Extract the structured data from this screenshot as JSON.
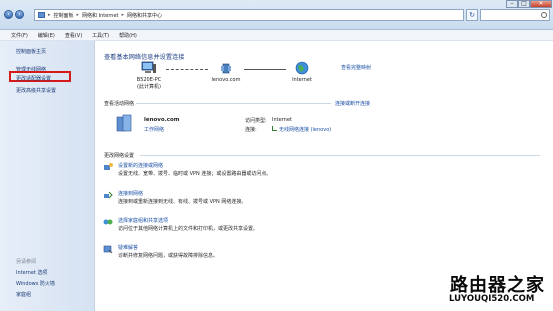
{
  "address_bar": {
    "segments": [
      "控制面板",
      "网络和 Internet",
      "网络和共享中心"
    ],
    "separator": "▸"
  },
  "menu": [
    "文件(F)",
    "编辑(E)",
    "查看(V)",
    "工具(T)",
    "帮助(H)"
  ],
  "sidebar": {
    "home": "控制面板主页",
    "items": [
      {
        "label": "管理无线网络"
      },
      {
        "label": "更改适配器设置",
        "highlighted": true
      },
      {
        "label": "更改高级共享设置"
      }
    ],
    "see_also_title": "另请参阅",
    "see_also": [
      "Internet 选项",
      "Windows 防火墙",
      "家庭组"
    ]
  },
  "main": {
    "title": "查看基本网络信息并设置连接",
    "view_full_map": "查看完整映射",
    "map": {
      "pc_name": "B520E-PC",
      "pc_sub": "(此计算机)",
      "network": "lenovo.com",
      "internet": "Internet"
    },
    "active_networks_head": "查看活动网络",
    "connect_disconnect": "连接或断开连接",
    "network_name": "lenovo.com",
    "network_type": "工作网络",
    "access_type_label": "访问类型:",
    "access_type_value": "Internet",
    "connection_label": "连接:",
    "connection_value": "无线网络连接 (lenovo)",
    "change_settings_head": "更改网络设置",
    "tasks": [
      {
        "title": "设置新的连接或网络",
        "desc": "设置无线、宽带、拨号、临时或 VPN 连接；或设置路由器或访问点。"
      },
      {
        "title": "连接到网络",
        "desc": "连接到或重新连接到无线、有线、拨号或 VPN 网络连接。"
      },
      {
        "title": "选择家庭组和共享选项",
        "desc": "访问位于其他网络计算机上的文件和打印机，或更改共享设置。"
      },
      {
        "title": "疑难解答",
        "desc": "诊断并修复网络问题，或获得故障排除信息。"
      }
    ]
  },
  "watermark": {
    "text_cn": "路由器之家",
    "url": "LUYOUQI520.COM"
  }
}
